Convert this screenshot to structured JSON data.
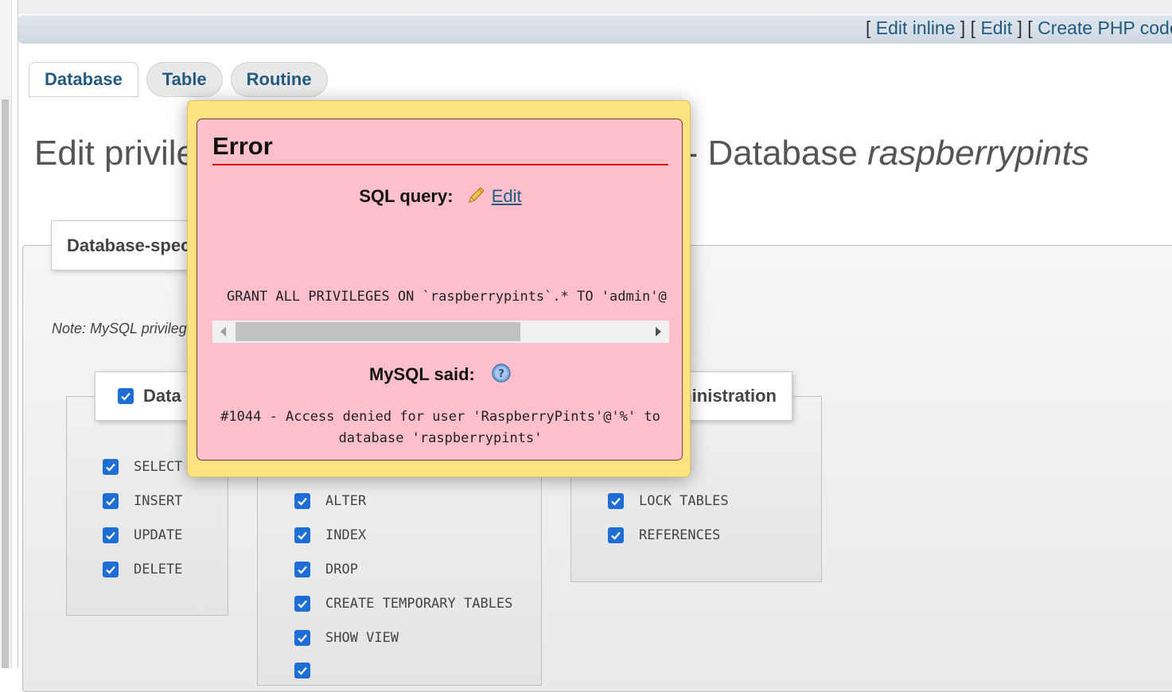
{
  "sql_links": {
    "open": "[ ",
    "sep": " ] [ ",
    "edit_inline": "Edit inline",
    "edit": "Edit",
    "create_php": "Create PHP code"
  },
  "tabs": [
    {
      "label": "Database"
    },
    {
      "label": "Table"
    },
    {
      "label": "Routine"
    }
  ],
  "page_title": {
    "prefix": "Edit privile",
    "suffix": "' - Database ",
    "database": "raspberrypints"
  },
  "fieldset_legend": "Database-specific",
  "note": "Note: MySQL privilege",
  "groups": {
    "data": {
      "legend": "Data",
      "items": [
        "SELECT",
        "INSERT",
        "UPDATE",
        "DELETE"
      ]
    },
    "structure": {
      "items": [
        "ALTER",
        "INDEX",
        "DROP",
        "CREATE TEMPORARY TABLES",
        "SHOW VIEW"
      ]
    },
    "administration": {
      "legend": "Administration",
      "items": [
        "LOCK TABLES",
        "REFERENCES"
      ]
    }
  },
  "error_dialog": {
    "title": "Error",
    "sql_query_label": "SQL query:",
    "edit_link": "Edit",
    "query": "GRANT ALL PRIVILEGES ON  `raspberrypints`.* TO 'admin'@'%';",
    "mysql_said_label": "MySQL said:",
    "message_line1": "#1044 - Access denied for user 'RaspberryPints'@'%' to",
    "message_line2": "database 'raspberrypints'"
  },
  "colors": {
    "link": "#235a81",
    "error_bg": "#ffc0cb",
    "dialog_bg": "#fde37f",
    "rule": "#dd0000",
    "checkbox": "#1e6ed6"
  }
}
